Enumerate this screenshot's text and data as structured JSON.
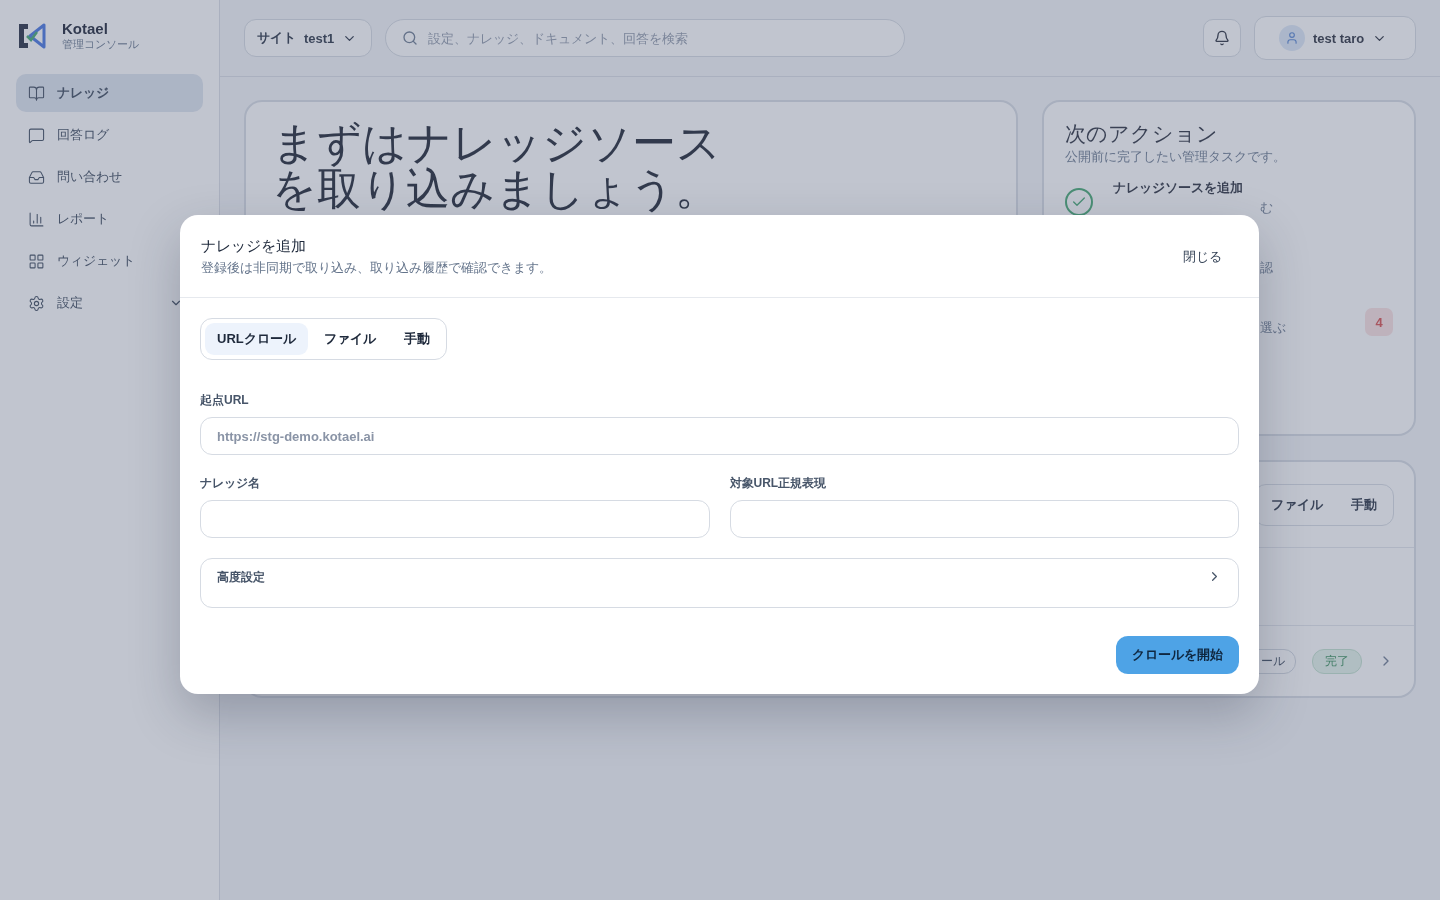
{
  "sidebar": {
    "brand": {
      "name": "Kotael",
      "subtitle": "管理コンソール"
    },
    "items": [
      {
        "label": "ナレッジ",
        "selected": true,
        "kind": "link"
      },
      {
        "label": "回答ログ",
        "selected": false,
        "kind": "link"
      },
      {
        "label": "問い合わせ",
        "selected": false,
        "kind": "link"
      },
      {
        "label": "レポート",
        "selected": false,
        "kind": "link"
      },
      {
        "label": "ウィジェット",
        "selected": false,
        "kind": "link"
      },
      {
        "label": "設定",
        "selected": false,
        "kind": "group"
      }
    ]
  },
  "topbar": {
    "site_selector": {
      "label": "サイト",
      "value": "test1"
    },
    "search": {
      "placeholder": "設定、ナレッジ、ドキュメント、回答を検索"
    },
    "user": {
      "name": "test taro"
    }
  },
  "hero": {
    "title_lines": [
      "まずはナレッジソース",
      "を取り込みましょう。"
    ]
  },
  "next_actions": {
    "title": "次のアクション",
    "subtitle": "公開前に完了したい管理タスクです。",
    "items": [
      {
        "title": "ナレッジソースを追加",
        "description": "む",
        "done": true
      },
      {
        "description": "認"
      },
      {
        "description": "選ぶ",
        "badge": "4"
      }
    ]
  },
  "sources": {
    "tabs": [
      {
        "label": "ファイル"
      },
      {
        "label": "手動"
      }
    ],
    "rows": [
      {
        "type": "ール",
        "status": "完了"
      }
    ]
  },
  "modal": {
    "title": "ナレッジを追加",
    "subtitle": "登録後は非同期で取り込み、取り込み履歴で確認できます。",
    "close": "閉じる",
    "tabs": [
      {
        "label": "URLクロール",
        "selected": true
      },
      {
        "label": "ファイル",
        "selected": false
      },
      {
        "label": "手動",
        "selected": false
      }
    ],
    "start_url": {
      "label": "起点URL",
      "placeholder": "https://stg-demo.kotael.ai"
    },
    "name": {
      "label": "ナレッジ名"
    },
    "pattern": {
      "label": "対象URL正規表現"
    },
    "advanced": {
      "label": "高度設定",
      "expanded": false
    },
    "submit": "クロールを開始"
  }
}
